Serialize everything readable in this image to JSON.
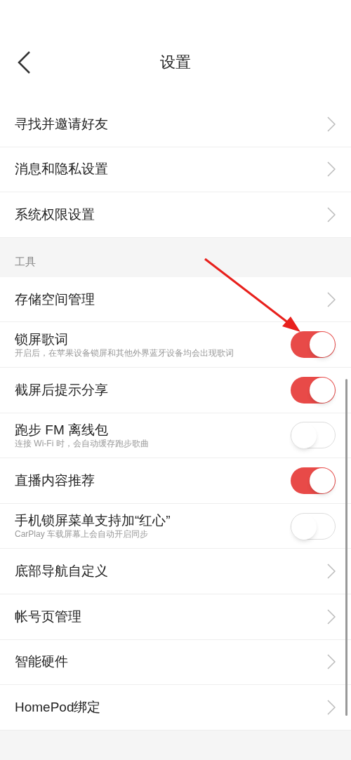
{
  "header": {
    "title": "设置"
  },
  "sections": [
    {
      "items": [
        {
          "kind": "link",
          "label": "寻找并邀请好友"
        },
        {
          "kind": "link",
          "label": "消息和隐私设置"
        },
        {
          "kind": "link",
          "label": "系统权限设置"
        }
      ]
    },
    {
      "title": "工具",
      "items": [
        {
          "kind": "link",
          "label": "存储空间管理"
        },
        {
          "kind": "toggle",
          "label": "锁屏歌词",
          "subtitle": "开启后，在苹果设备锁屏和其他外界蓝牙设备均会出现歌词",
          "on": true
        },
        {
          "kind": "toggle",
          "label": "截屏后提示分享",
          "on": true
        },
        {
          "kind": "toggle",
          "label": "跑步 FM 离线包",
          "subtitle": "连接 Wi-Fi 时，会自动缓存跑步歌曲",
          "on": false
        },
        {
          "kind": "toggle",
          "label": "直播内容推荐",
          "on": true
        },
        {
          "kind": "toggle",
          "label": "手机锁屏菜单支持加“红心”",
          "subtitle": "CarPlay 车载屏幕上会自动开启同步",
          "on": false
        },
        {
          "kind": "link",
          "label": "底部导航自定义"
        },
        {
          "kind": "link",
          "label": "帐号页管理"
        },
        {
          "kind": "link",
          "label": "智能硬件"
        },
        {
          "kind": "link",
          "label": "HomePod绑定"
        }
      ]
    }
  ]
}
